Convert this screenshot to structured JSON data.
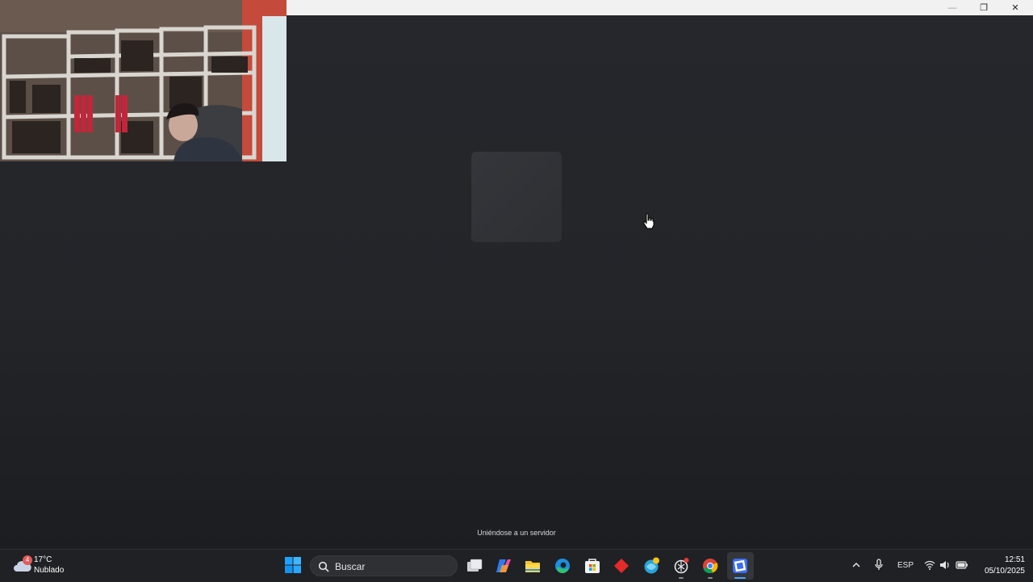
{
  "window": {
    "controls": {
      "minimize": "—",
      "maximize": "❐",
      "close": "✕"
    },
    "status_text": "Uniéndose a un servidor"
  },
  "taskbar": {
    "weather": {
      "temperature": "17°C",
      "condition": "Nublado",
      "badge_count": "4"
    },
    "search_placeholder": "Buscar",
    "apps": [
      {
        "icon": "task-view-icon"
      },
      {
        "icon": "copilot-icon"
      },
      {
        "icon": "file-explorer-icon"
      },
      {
        "icon": "edge-icon"
      },
      {
        "icon": "microsoft-store-icon"
      },
      {
        "icon": "red-diamond-app-icon"
      },
      {
        "icon": "browser-with-notification-icon"
      },
      {
        "icon": "chatgpt-icon"
      },
      {
        "icon": "chrome-icon"
      },
      {
        "icon": "roblox-icon"
      }
    ],
    "tray": {
      "language": "ESP",
      "time": "12:51",
      "date": "05/10/2025"
    }
  },
  "colors": {
    "background": "#232529",
    "taskbar": "#202124",
    "titlebar": "#f1f1f1",
    "windows_blue": "#1fa2ff"
  }
}
